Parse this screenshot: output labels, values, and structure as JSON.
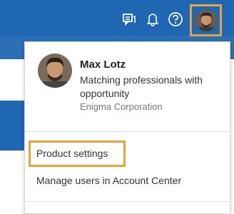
{
  "header": {
    "icons": [
      "chat-icon",
      "bell-icon",
      "help-icon"
    ]
  },
  "profile": {
    "name": "Max Lotz",
    "tagline": "Matching professionals with opportunity",
    "company": "Enigma Corporation"
  },
  "menu": {
    "items": [
      {
        "label": "Product settings"
      },
      {
        "label": "Manage users in Account Center"
      }
    ]
  },
  "colors": {
    "topbar": "#1f66b3",
    "highlight": "#e8a33a"
  }
}
